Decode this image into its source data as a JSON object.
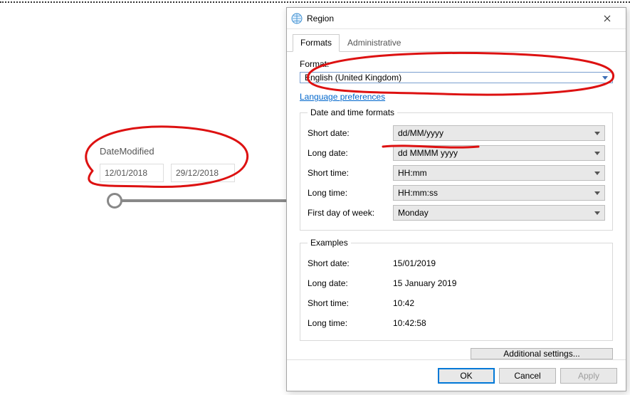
{
  "slicer": {
    "title": "DateModified",
    "from": "12/01/2018",
    "to": "29/12/2018"
  },
  "dialog": {
    "title": "Region",
    "tabs": {
      "formats": "Formats",
      "administrative": "Administrative"
    },
    "format_label": "Format:",
    "format_value": "English (United Kingdom)",
    "language_link": "Language preferences",
    "date_time_formats": {
      "legend": "Date and time formats",
      "short_date_label": "Short date:",
      "short_date_value": "dd/MM/yyyy",
      "long_date_label": "Long date:",
      "long_date_value": "dd MMMM yyyy",
      "short_time_label": "Short time:",
      "short_time_value": "HH:mm",
      "long_time_label": "Long time:",
      "long_time_value": "HH:mm:ss",
      "first_day_label": "First day of week:",
      "first_day_value": "Monday"
    },
    "examples": {
      "legend": "Examples",
      "short_date_label": "Short date:",
      "short_date_value": "15/01/2019",
      "long_date_label": "Long date:",
      "long_date_value": "15 January 2019",
      "short_time_label": "Short time:",
      "short_time_value": "10:42",
      "long_time_label": "Long time:",
      "long_time_value": "10:42:58"
    },
    "additional_settings": "Additional settings...",
    "buttons": {
      "ok": "OK",
      "cancel": "Cancel",
      "apply": "Apply"
    }
  }
}
